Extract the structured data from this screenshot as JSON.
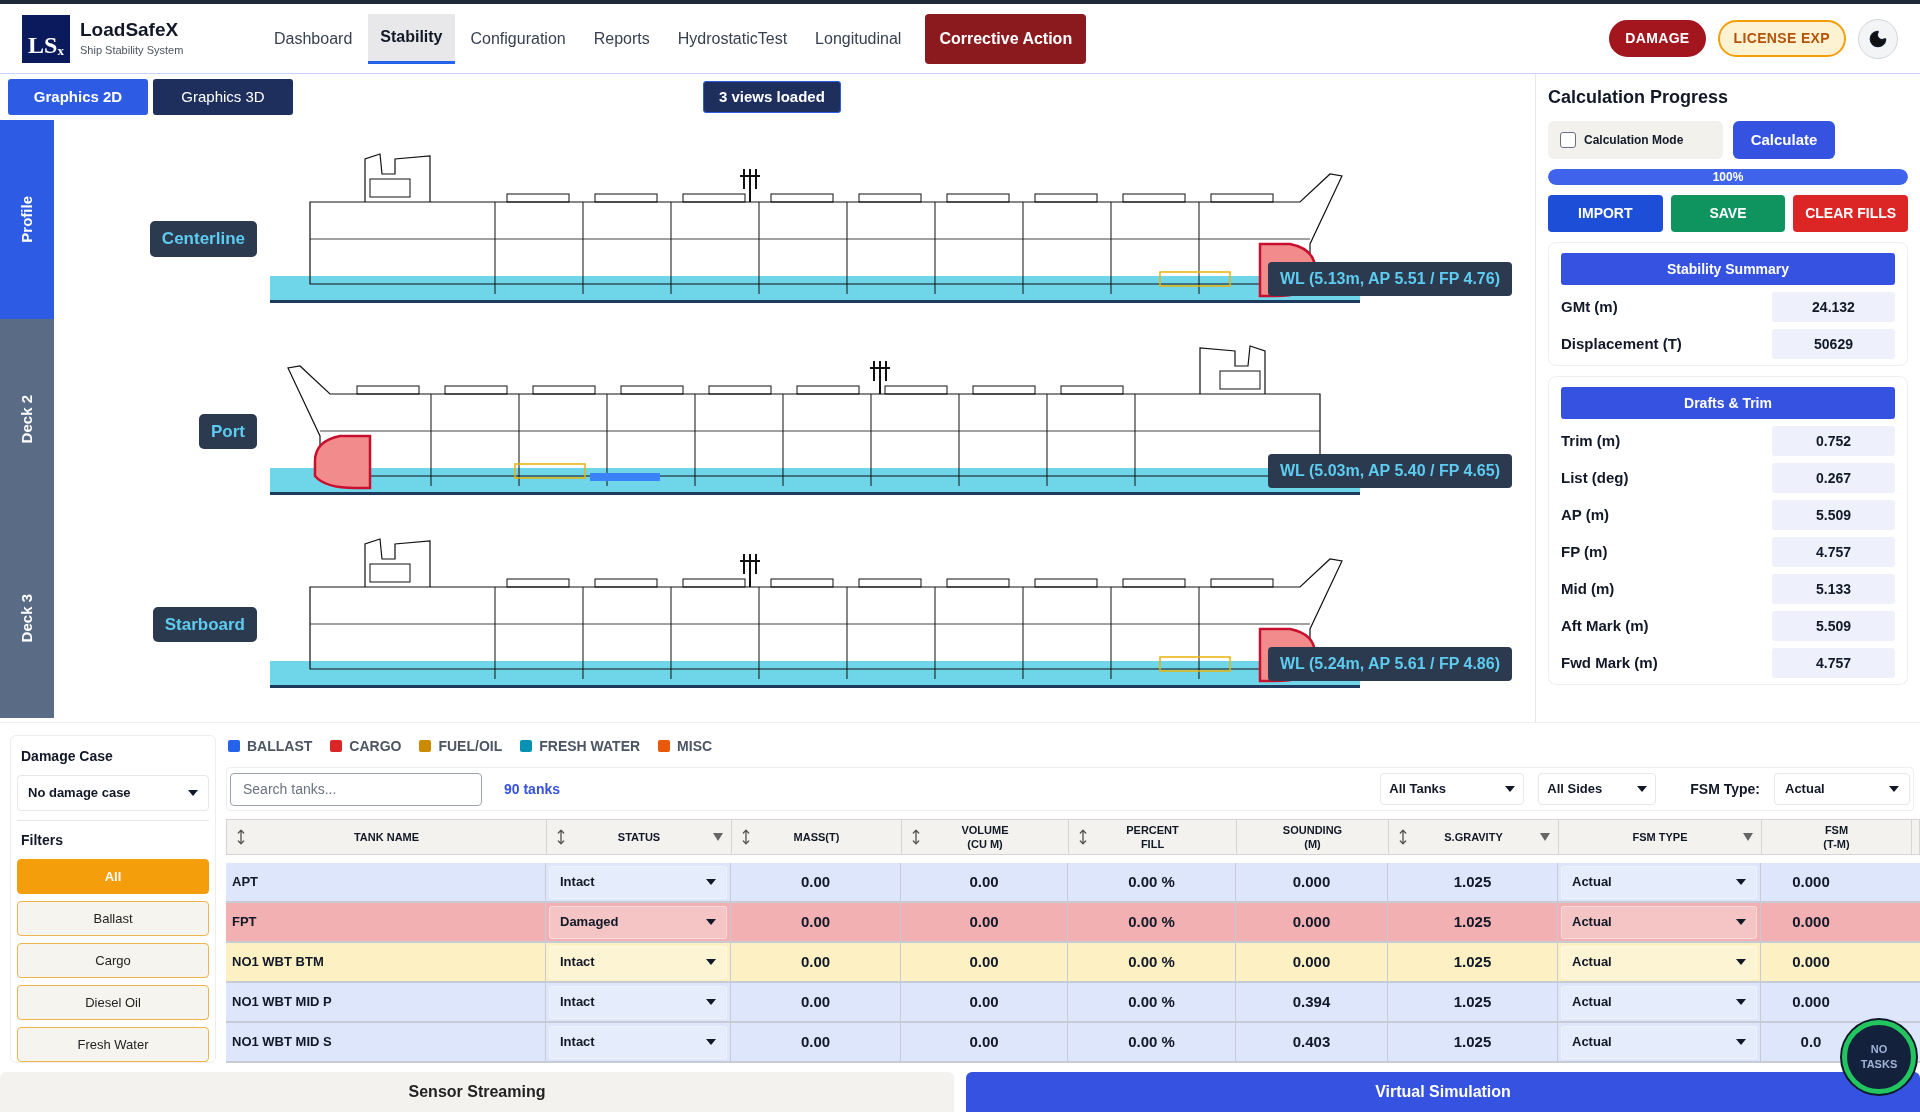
{
  "app": {
    "logo_mark": "LS",
    "logo_sub": "x",
    "name": "LoadSafeX",
    "subtitle": "Ship Stability System"
  },
  "nav": [
    {
      "label": "Dashboard",
      "selected": false,
      "kind": "link"
    },
    {
      "label": "Stability",
      "selected": true,
      "kind": "link"
    },
    {
      "label": "Configuration",
      "selected": false,
      "kind": "link"
    },
    {
      "label": "Reports",
      "selected": false,
      "kind": "link"
    },
    {
      "label": "HydrostaticTest",
      "selected": false,
      "kind": "link"
    },
    {
      "label": "Longitudinal",
      "selected": false,
      "kind": "link"
    },
    {
      "label": "Corrective Action",
      "selected": false,
      "kind": "action"
    }
  ],
  "badges": [
    {
      "label": "DAMAGE",
      "kind": "danger"
    },
    {
      "label": "LICENSE EXP",
      "kind": "warning"
    }
  ],
  "graphics_tabs": [
    {
      "label": "Graphics 2D",
      "selected": true
    },
    {
      "label": "Graphics 3D",
      "selected": false
    }
  ],
  "views_loaded": "3 views loaded",
  "view_tabs": [
    {
      "label": "Profile",
      "selected": true
    },
    {
      "label": "Deck 2",
      "selected": false
    },
    {
      "label": "Deck 3",
      "selected": false
    }
  ],
  "views": [
    {
      "label": "Centerline",
      "waterline": "WL (5.13m, AP 5.51 / FP 4.76)",
      "kind": "standard"
    },
    {
      "label": "Port",
      "waterline": "WL (5.03m, AP 5.40 / FP 4.65)",
      "kind": "mirrored"
    },
    {
      "label": "Starboard",
      "waterline": "WL (5.24m, AP 5.61 / FP 4.86)",
      "kind": "standard"
    }
  ],
  "calculation": {
    "title": "Calculation Progress",
    "mode_label": "Calculation Mode",
    "mode_checked": false,
    "calculate": "Calculate",
    "level": 1,
    "percent": "100%",
    "actions": [
      {
        "label": "IMPORT",
        "kind": "import"
      },
      {
        "label": "SAVE",
        "kind": "save"
      },
      {
        "label": "CLEAR FILLS",
        "kind": "clear"
      }
    ]
  },
  "summary_cards": [
    {
      "title": "Stability Summary",
      "rows": [
        {
          "label": "GMt (m)",
          "value": "24.132"
        },
        {
          "label": "Displacement (T)",
          "value": "50629"
        }
      ]
    },
    {
      "title": "Drafts & Trim",
      "rows": [
        {
          "label": "Trim (m)",
          "value": "0.752"
        },
        {
          "label": "List (deg)",
          "value": "0.267"
        },
        {
          "label": "AP (m)",
          "value": "5.509"
        },
        {
          "label": "FP (m)",
          "value": "4.757"
        },
        {
          "label": "Mid (m)",
          "value": "5.133"
        },
        {
          "label": "Aft Mark (m)",
          "value": "5.509"
        },
        {
          "label": "Fwd Mark (m)",
          "value": "4.757"
        }
      ]
    }
  ],
  "damage_case": {
    "title": "Damage Case",
    "value": "No damage case"
  },
  "filters": {
    "title": "Filters",
    "items": [
      {
        "label": "All",
        "selected": true
      },
      {
        "label": "Ballast",
        "selected": false
      },
      {
        "label": "Cargo",
        "selected": false
      },
      {
        "label": "Diesel Oil",
        "selected": false
      },
      {
        "label": "Fresh Water",
        "selected": false
      }
    ]
  },
  "legend": [
    {
      "label": "BALLAST",
      "color": "#2563eb"
    },
    {
      "label": "CARGO",
      "color": "#dc2626"
    },
    {
      "label": "FUEL/OIL",
      "color": "#ca8a04"
    },
    {
      "label": "FRESH WATER",
      "color": "#0891b2"
    },
    {
      "label": "MISC",
      "color": "#ea580c"
    }
  ],
  "toolbar": {
    "search_placeholder": "Search tanks...",
    "count": "90 tanks",
    "tank_filter": "All Tanks",
    "side_filter": "All Sides",
    "fsm_label": "FSM Type:",
    "fsm_value": "Actual"
  },
  "table": {
    "columns": [
      {
        "label": "TANK NAME",
        "sortable": true,
        "filterable": false
      },
      {
        "label": "STATUS",
        "sortable": true,
        "filterable": true
      },
      {
        "label": "MASS(T)",
        "sortable": true,
        "filterable": false
      },
      {
        "label": "VOLUME\n(CU M)",
        "sortable": true,
        "filterable": false
      },
      {
        "label": "PERCENT\nFILL",
        "sortable": true,
        "filterable": false
      },
      {
        "label": "SOUNDING\n(M)",
        "sortable": false,
        "filterable": false
      },
      {
        "label": "S.GRAVITY",
        "sortable": true,
        "filterable": true
      },
      {
        "label": "FSM TYPE",
        "sortable": false,
        "filterable": true
      },
      {
        "label": "FSM\n(T-M)",
        "sortable": false,
        "filterable": false
      }
    ],
    "rows": [
      {
        "name": "APT",
        "status": "Intact",
        "kind": "normal",
        "mass": "0.00",
        "volume": "0.00",
        "percent": "0.00 %",
        "sounding": "0.000",
        "gravity": "1.025",
        "fsm_type": "Actual",
        "fsm": "0.000"
      },
      {
        "name": "FPT",
        "status": "Damaged",
        "kind": "damaged",
        "mass": "0.00",
        "volume": "0.00",
        "percent": "0.00 %",
        "sounding": "0.000",
        "gravity": "1.025",
        "fsm_type": "Actual",
        "fsm": "0.000"
      },
      {
        "name": "NO1 WBT BTM",
        "status": "Intact",
        "kind": "highlighted",
        "mass": "0.00",
        "volume": "0.00",
        "percent": "0.00 %",
        "sounding": "0.000",
        "gravity": "1.025",
        "fsm_type": "Actual",
        "fsm": "0.000"
      },
      {
        "name": "NO1 WBT MID P",
        "status": "Intact",
        "kind": "normal",
        "mass": "0.00",
        "volume": "0.00",
        "percent": "0.00 %",
        "sounding": "0.394",
        "gravity": "1.025",
        "fsm_type": "Actual",
        "fsm": "0.000"
      },
      {
        "name": "NO1 WBT MID S",
        "status": "Intact",
        "kind": "normal",
        "mass": "0.00",
        "volume": "0.00",
        "percent": "0.00 %",
        "sounding": "0.403",
        "gravity": "1.025",
        "fsm_type": "Actual",
        "fsm": "0.0"
      }
    ]
  },
  "bottom_tabs": [
    {
      "label": "Sensor Streaming",
      "selected": false
    },
    {
      "label": "Virtual Simulation",
      "selected": true
    }
  ],
  "task_badge": "NO\nTASKS"
}
